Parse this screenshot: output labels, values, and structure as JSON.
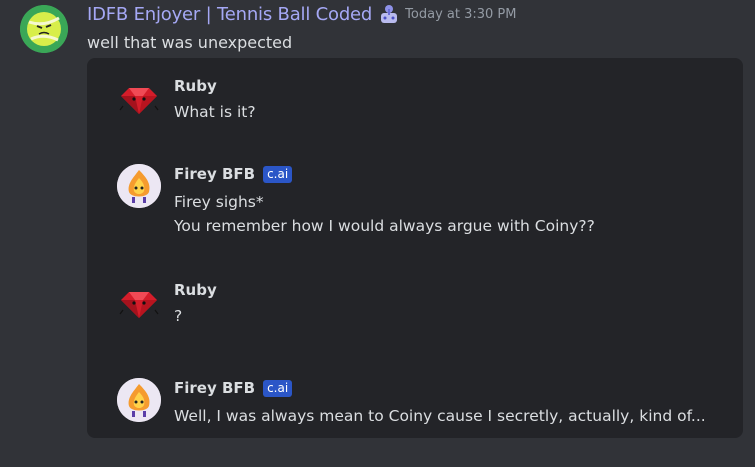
{
  "post": {
    "author": "IDFB Enjoyer | Tennis Ball Coded",
    "author_color": "#a5a8f5",
    "bot_icon": "robot-joystick-icon",
    "timestamp": "Today at 3:30 PM",
    "text": "well that was unexpected"
  },
  "embed": {
    "messages": [
      {
        "name": "Ruby",
        "avatar": "ruby-gem-icon",
        "lines": [
          "What is it?"
        ]
      },
      {
        "name": "Firey BFB",
        "tag": "c.ai",
        "avatar": "firey-flame-avatar",
        "lines": [
          "Firey sighs*",
          "You remember how I would always argue with Coiny??"
        ]
      },
      {
        "name": "Ruby",
        "avatar": "ruby-gem-icon",
        "lines": [
          "?"
        ]
      },
      {
        "name": "Firey BFB",
        "tag": "c.ai",
        "avatar": "firey-flame-avatar",
        "lines": [
          "Well, I was always mean to Coiny cause I secretly, actually, kind of..."
        ]
      }
    ]
  }
}
